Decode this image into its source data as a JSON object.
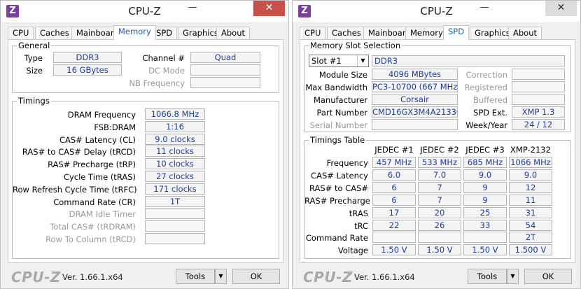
{
  "left": {
    "title": "CPU-Z",
    "tabs": [
      "CPU",
      "Caches",
      "Mainboard",
      "Memory",
      "SPD",
      "Graphics",
      "About"
    ],
    "active_tab": "Memory",
    "general": {
      "title": "General",
      "type_label": "Type",
      "type_value": "DDR3",
      "size_label": "Size",
      "size_value": "16 GBytes",
      "channel_label": "Channel #",
      "channel_value": "Quad",
      "dcmode_label": "DC Mode",
      "nbfreq_label": "NB Frequency"
    },
    "timings": {
      "title": "Timings",
      "rows": [
        {
          "label": "DRAM Frequency",
          "value": "1066.8 MHz"
        },
        {
          "label": "FSB:DRAM",
          "value": "1:16"
        },
        {
          "label": "CAS# Latency (CL)",
          "value": "9.0 clocks"
        },
        {
          "label": "RAS# to CAS# Delay (tRCD)",
          "value": "11 clocks"
        },
        {
          "label": "RAS# Precharge (tRP)",
          "value": "10 clocks"
        },
        {
          "label": "Cycle Time (tRAS)",
          "value": "27 clocks"
        },
        {
          "label": "Row Refresh Cycle Time (tRFC)",
          "value": "171 clocks"
        },
        {
          "label": "Command Rate (CR)",
          "value": "1T"
        },
        {
          "label": "DRAM Idle Timer",
          "value": ""
        },
        {
          "label": "Total CAS# (tRDRAM)",
          "value": ""
        },
        {
          "label": "Row To Column (tRCD)",
          "value": ""
        }
      ]
    },
    "footer": {
      "logo": "CPU-Z",
      "version": "Ver. 1.66.1.x64",
      "tools": "Tools",
      "ok": "OK"
    }
  },
  "right": {
    "title": "CPU-Z",
    "tabs": [
      "CPU",
      "Caches",
      "Mainboard",
      "Memory",
      "SPD",
      "Graphics",
      "About"
    ],
    "active_tab": "SPD",
    "slot": {
      "title": "Memory Slot Selection",
      "selected": "Slot #1",
      "type": "DDR3",
      "module_size_label": "Module Size",
      "module_size": "4096 MBytes",
      "max_bw_label": "Max Bandwidth",
      "max_bw": "PC3-10700 (667 MHz)",
      "manufacturer_label": "Manufacturer",
      "manufacturer": "Corsair",
      "part_label": "Part Number",
      "part": "CMD16GX3M4A2133C9",
      "serial_label": "Serial Number",
      "serial": "",
      "correction_label": "Correction",
      "registered_label": "Registered",
      "buffered_label": "Buffered",
      "spd_ext_label": "SPD Ext.",
      "spd_ext": "XMP 1.3",
      "week_year_label": "Week/Year",
      "week_year": "24 / 12"
    },
    "timings_table": {
      "title": "Timings Table",
      "headers": [
        "JEDEC #1",
        "JEDEC #2",
        "JEDEC #3",
        "XMP-2132"
      ],
      "rows": [
        {
          "label": "Frequency",
          "values": [
            "457 MHz",
            "533 MHz",
            "685 MHz",
            "1066 MHz"
          ]
        },
        {
          "label": "CAS# Latency",
          "values": [
            "6.0",
            "7.0",
            "9.0",
            "9.0"
          ]
        },
        {
          "label": "RAS# to CAS#",
          "values": [
            "6",
            "7",
            "9",
            "12"
          ]
        },
        {
          "label": "RAS# Precharge",
          "values": [
            "6",
            "7",
            "9",
            "11"
          ]
        },
        {
          "label": "tRAS",
          "values": [
            "17",
            "20",
            "25",
            "31"
          ]
        },
        {
          "label": "tRC",
          "values": [
            "22",
            "26",
            "33",
            "54"
          ]
        },
        {
          "label": "Command Rate",
          "values": [
            "",
            "",
            "",
            "2T"
          ]
        },
        {
          "label": "Voltage",
          "values": [
            "1.50 V",
            "1.50 V",
            "1.50 V",
            "1.500 V"
          ]
        }
      ]
    },
    "footer": {
      "logo": "CPU-Z",
      "version": "Ver. 1.66.1.x64",
      "tools": "Tools",
      "ok": "OK"
    }
  },
  "icons": {
    "app": "Z",
    "minimize": "—",
    "close": "✕",
    "dropdown": "▼"
  }
}
